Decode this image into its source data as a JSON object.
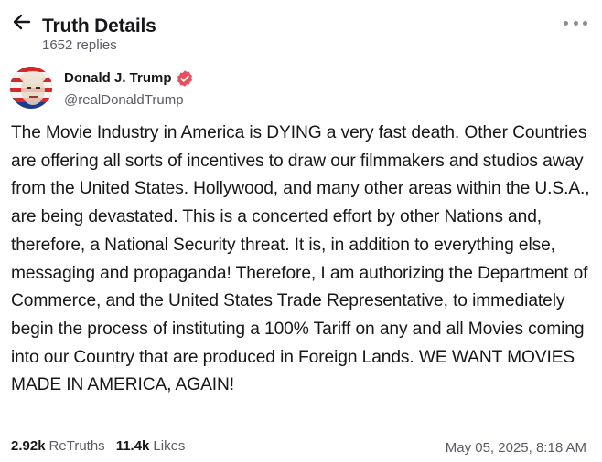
{
  "header": {
    "title": "Truth Details",
    "subtitle": "1652 replies"
  },
  "author": {
    "display_name": "Donald J. Trump",
    "handle": "@realDonaldTrump",
    "verified_color": "#e8505b"
  },
  "post": {
    "text": "The Movie Industry in America is DYING a very fast death. Other Countries are offering all sorts of incentives to draw our filmmakers and studios away from the United States. Hollywood, and many other areas within the U.S.A., are being devastated. This is a concerted effort by other Nations and, therefore, a National Security threat. It is, in addition to everything else, messaging and propaganda! Therefore, I am authorizing the Department of Commerce, and the United States Trade Representative, to immediately begin the process of instituting a 100% Tariff on any and all Movies coming into our Country that are produced in Foreign Lands. WE WANT MOVIES MADE IN AMERICA, AGAIN!",
    "retruths_count": "2.92k",
    "retruths_label": "ReTruths",
    "likes_count": "11.4k",
    "likes_label": "Likes",
    "timestamp": "May 05, 2025, 8:18 AM"
  },
  "icons": {
    "back": "arrow-left-icon",
    "more": "more-horizontal-icon",
    "verified": "verified-badge-icon"
  }
}
